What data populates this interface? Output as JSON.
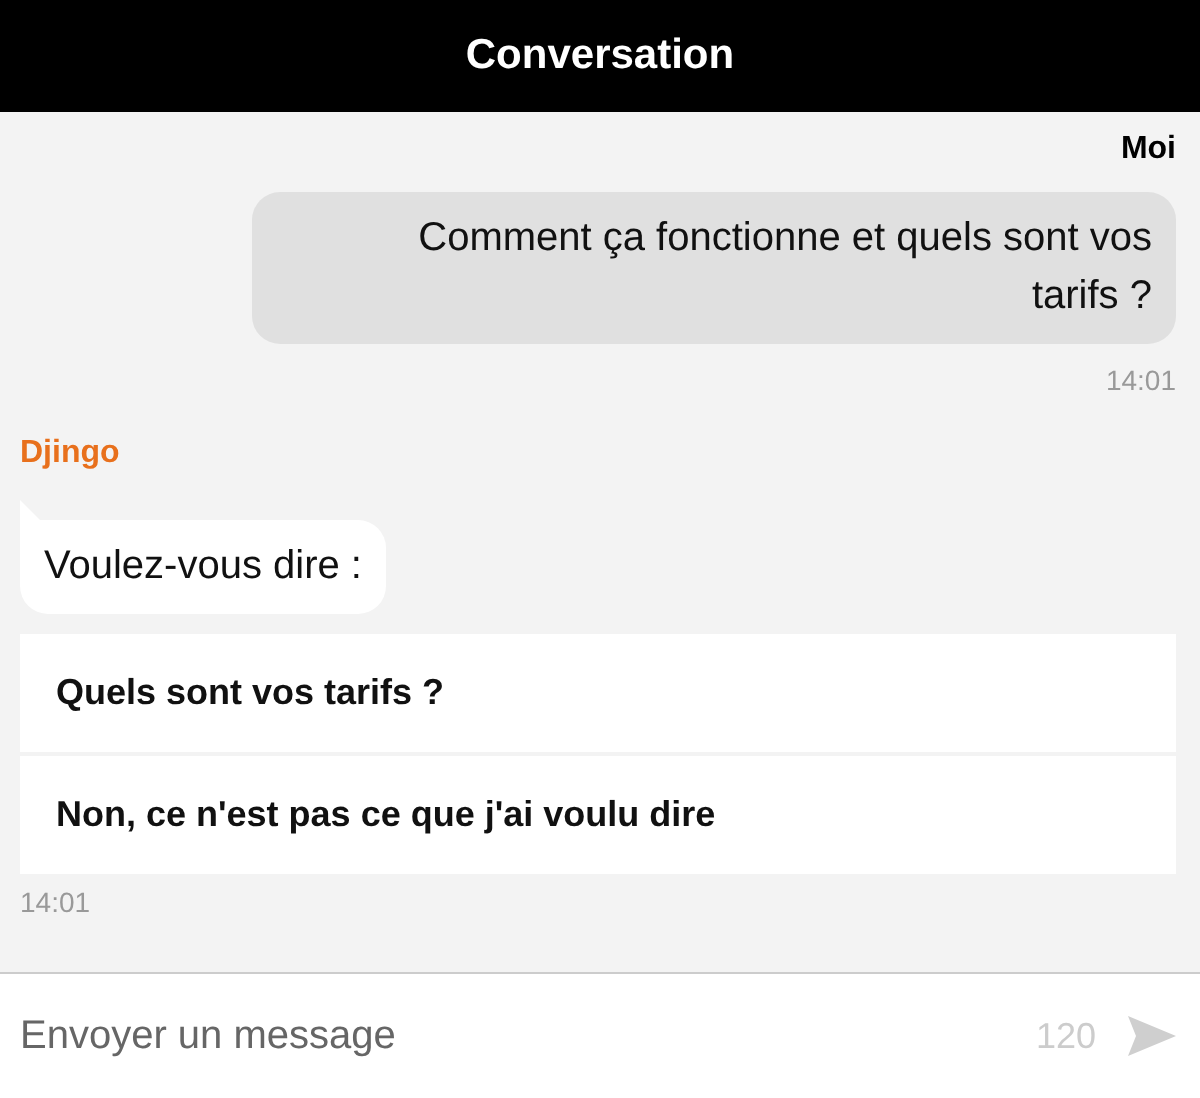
{
  "header": {
    "title": "Conversation"
  },
  "messages": [
    {
      "kind": "user",
      "sender": "Moi",
      "text": "Comment ça fonctionne et quels sont vos tarifs ?",
      "time": "14:01"
    },
    {
      "kind": "bot",
      "sender": "Djingo",
      "text": "Voulez-vous dire :",
      "options": [
        "Quels sont vos tarifs ?",
        "Non, ce n'est pas ce que j'ai voulu dire"
      ],
      "time": "14:01"
    }
  ],
  "composer": {
    "placeholder": "Envoyer un message",
    "counter": "120"
  }
}
